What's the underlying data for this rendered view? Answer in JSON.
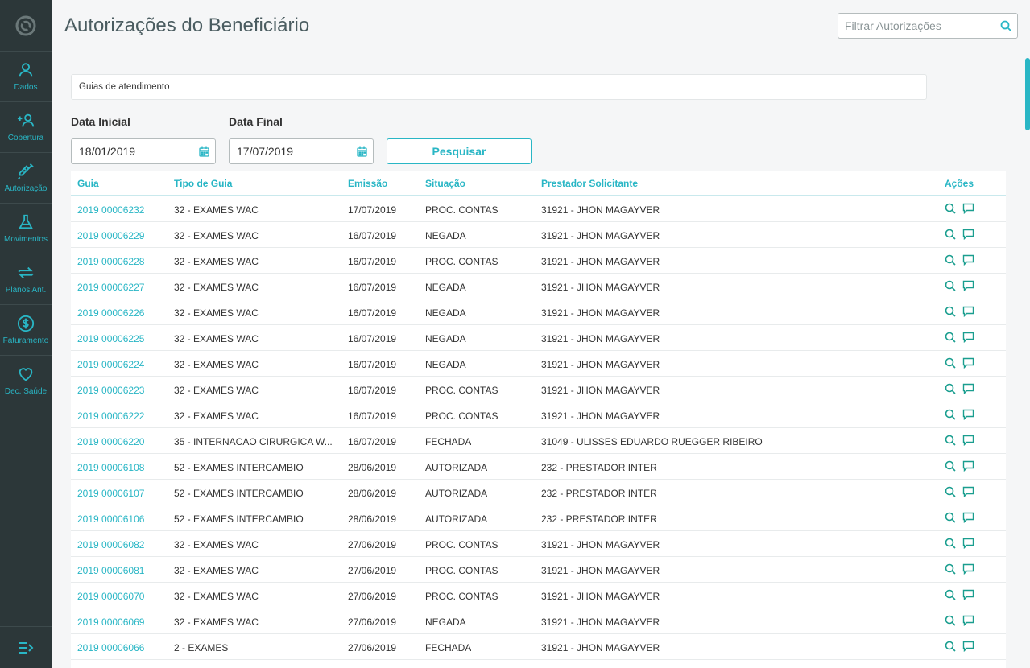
{
  "page": {
    "title": "Autorizações do Beneficiário"
  },
  "filter": {
    "placeholder": "Filtrar Autorizações",
    "icon": "search-icon"
  },
  "sidebar": {
    "logo_icon": "logo-icon",
    "items": [
      {
        "label": "Dados",
        "icon": "user-icon"
      },
      {
        "label": "Cobertura",
        "icon": "add-user-icon"
      },
      {
        "label": "Autorização",
        "icon": "syringe-icon"
      },
      {
        "label": "Movimentos",
        "icon": "flask-icon"
      },
      {
        "label": "Planos Ant.",
        "icon": "swap-icon"
      },
      {
        "label": "Faturamento",
        "icon": "dollar-icon"
      },
      {
        "label": "Dec. Saúde",
        "icon": "heart-icon"
      }
    ],
    "collapse_icon": "collapse-menu-icon"
  },
  "form": {
    "guias_type": "Guias de atendimento",
    "data_inicial_label": "Data Inicial",
    "data_inicial_value": "18/01/2019",
    "data_final_label": "Data Final",
    "data_final_value": "17/07/2019",
    "search_button": "Pesquisar"
  },
  "table": {
    "headers": [
      "Guia",
      "Tipo de Guia",
      "Emissão",
      "Situação",
      "Prestador Solicitante",
      "Ações"
    ],
    "rows": [
      [
        "2019 00006232",
        "32 - EXAMES WAC",
        "17/07/2019",
        "PROC. CONTAS",
        "31921 - JHON MAGAYVER"
      ],
      [
        "2019 00006229",
        "32 - EXAMES WAC",
        "16/07/2019",
        "NEGADA",
        "31921 - JHON MAGAYVER"
      ],
      [
        "2019 00006228",
        "32 - EXAMES WAC",
        "16/07/2019",
        "PROC. CONTAS",
        "31921 - JHON MAGAYVER"
      ],
      [
        "2019 00006227",
        "32 - EXAMES WAC",
        "16/07/2019",
        "NEGADA",
        "31921 - JHON MAGAYVER"
      ],
      [
        "2019 00006226",
        "32 - EXAMES WAC",
        "16/07/2019",
        "NEGADA",
        "31921 - JHON MAGAYVER"
      ],
      [
        "2019 00006225",
        "32 - EXAMES WAC",
        "16/07/2019",
        "NEGADA",
        "31921 - JHON MAGAYVER"
      ],
      [
        "2019 00006224",
        "32 - EXAMES WAC",
        "16/07/2019",
        "NEGADA",
        "31921 - JHON MAGAYVER"
      ],
      [
        "2019 00006223",
        "32 - EXAMES WAC",
        "16/07/2019",
        "PROC. CONTAS",
        "31921 - JHON MAGAYVER"
      ],
      [
        "2019 00006222",
        "32 - EXAMES WAC",
        "16/07/2019",
        "PROC. CONTAS",
        "31921 - JHON MAGAYVER"
      ],
      [
        "2019 00006220",
        "35 - INTERNACAO CIRURGICA W...",
        "16/07/2019",
        "FECHADA",
        "31049 - ULISSES EDUARDO RUEGGER RIBEIRO"
      ],
      [
        "2019 00006108",
        "52 - EXAMES INTERCAMBIO",
        "28/06/2019",
        "AUTORIZADA",
        "232 - PRESTADOR INTER"
      ],
      [
        "2019 00006107",
        "52 - EXAMES INTERCAMBIO",
        "28/06/2019",
        "AUTORIZADA",
        "232 - PRESTADOR INTER"
      ],
      [
        "2019 00006106",
        "52 - EXAMES INTERCAMBIO",
        "28/06/2019",
        "AUTORIZADA",
        "232 - PRESTADOR INTER"
      ],
      [
        "2019 00006082",
        "32 - EXAMES WAC",
        "27/06/2019",
        "PROC. CONTAS",
        "31921 - JHON MAGAYVER"
      ],
      [
        "2019 00006081",
        "32 - EXAMES WAC",
        "27/06/2019",
        "PROC. CONTAS",
        "31921 - JHON MAGAYVER"
      ],
      [
        "2019 00006070",
        "32 - EXAMES WAC",
        "27/06/2019",
        "PROC. CONTAS",
        "31921 - JHON MAGAYVER"
      ],
      [
        "2019 00006069",
        "32 - EXAMES WAC",
        "27/06/2019",
        "NEGADA",
        "31921 - JHON MAGAYVER"
      ],
      [
        "2019 00006066",
        "2 - EXAMES",
        "27/06/2019",
        "FECHADA",
        "31921 - JHON MAGAYVER"
      ]
    ],
    "action_icons": [
      "view-details-icon",
      "comment-icon"
    ]
  },
  "colors": {
    "accent": "#29b6c5",
    "sidebar_bg": "#2c3739",
    "page_bg": "#f5f6f7",
    "action_icon": "#1a9e8f"
  }
}
